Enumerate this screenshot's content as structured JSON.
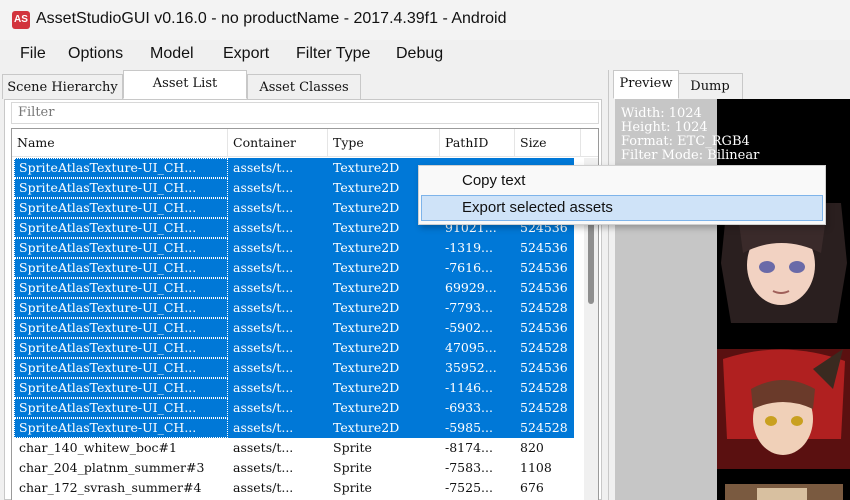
{
  "window": {
    "app_icon_text": "AS",
    "title": "AssetStudioGUI v0.16.0 - no productName - 2017.4.39f1 - Android"
  },
  "menu": [
    "File",
    "Options",
    "Model",
    "Export",
    "Filter Type",
    "Debug"
  ],
  "left_tabs": [
    "Scene Hierarchy",
    "Asset List",
    "Asset Classes"
  ],
  "filter": {
    "placeholder": "Filter"
  },
  "columns": [
    "Name",
    "Container",
    "Type",
    "PathID",
    "Size"
  ],
  "rows": [
    {
      "name": "SpriteAtlasTexture-UI_CH...",
      "container": "assets/t...",
      "type": "Texture2D",
      "pathid": "",
      "size": "",
      "selected": true
    },
    {
      "name": "SpriteAtlasTexture-UI_CH...",
      "container": "assets/t...",
      "type": "Texture2D",
      "pathid": "",
      "size": "",
      "selected": true
    },
    {
      "name": "SpriteAtlasTexture-UI_CH...",
      "container": "assets/t...",
      "type": "Texture2D",
      "pathid": "",
      "size": "",
      "selected": true
    },
    {
      "name": "SpriteAtlasTexture-UI_CH...",
      "container": "assets/t...",
      "type": "Texture2D",
      "pathid": "91021...",
      "size": "524536",
      "selected": true
    },
    {
      "name": "SpriteAtlasTexture-UI_CH...",
      "container": "assets/t...",
      "type": "Texture2D",
      "pathid": "-1319...",
      "size": "524536",
      "selected": true
    },
    {
      "name": "SpriteAtlasTexture-UI_CH...",
      "container": "assets/t...",
      "type": "Texture2D",
      "pathid": "-7616...",
      "size": "524536",
      "selected": true
    },
    {
      "name": "SpriteAtlasTexture-UI_CH...",
      "container": "assets/t...",
      "type": "Texture2D",
      "pathid": "69929...",
      "size": "524536",
      "selected": true
    },
    {
      "name": "SpriteAtlasTexture-UI_CH...",
      "container": "assets/t...",
      "type": "Texture2D",
      "pathid": "-7793...",
      "size": "524528",
      "selected": true
    },
    {
      "name": "SpriteAtlasTexture-UI_CH...",
      "container": "assets/t...",
      "type": "Texture2D",
      "pathid": "-5902...",
      "size": "524536",
      "selected": true
    },
    {
      "name": "SpriteAtlasTexture-UI_CH...",
      "container": "assets/t...",
      "type": "Texture2D",
      "pathid": "47095...",
      "size": "524528",
      "selected": true
    },
    {
      "name": "SpriteAtlasTexture-UI_CH...",
      "container": "assets/t...",
      "type": "Texture2D",
      "pathid": "35952...",
      "size": "524536",
      "selected": true
    },
    {
      "name": "SpriteAtlasTexture-UI_CH...",
      "container": "assets/t...",
      "type": "Texture2D",
      "pathid": "-1146...",
      "size": "524528",
      "selected": true
    },
    {
      "name": "SpriteAtlasTexture-UI_CH...",
      "container": "assets/t...",
      "type": "Texture2D",
      "pathid": "-6933...",
      "size": "524528",
      "selected": true
    },
    {
      "name": "SpriteAtlasTexture-UI_CH...",
      "container": "assets/t...",
      "type": "Texture2D",
      "pathid": "-5985...",
      "size": "524528",
      "selected": true
    },
    {
      "name": "char_140_whitew_boc#1",
      "container": "assets/t...",
      "type": "Sprite",
      "pathid": "-8174...",
      "size": "820",
      "selected": false
    },
    {
      "name": "char_204_platnm_summer#3",
      "container": "assets/t...",
      "type": "Sprite",
      "pathid": "-7583...",
      "size": "1108",
      "selected": false
    },
    {
      "name": "char_172_svrash_summer#4",
      "container": "assets/t...",
      "type": "Sprite",
      "pathid": "-7525...",
      "size": "676",
      "selected": false
    }
  ],
  "right_tabs": [
    "Preview",
    "Dump"
  ],
  "preview_info": [
    "Width: 1024",
    "Height: 1024",
    "Format: ETC_RGB4",
    "Filter Mode: Bilinear"
  ],
  "context_menu": {
    "items": [
      "Copy text",
      "Export selected assets"
    ],
    "hovered_index": 1
  },
  "colors": {
    "selection": "#0078d7",
    "menu_hover": "#cfe3f8",
    "app_icon": "#d2343d"
  }
}
